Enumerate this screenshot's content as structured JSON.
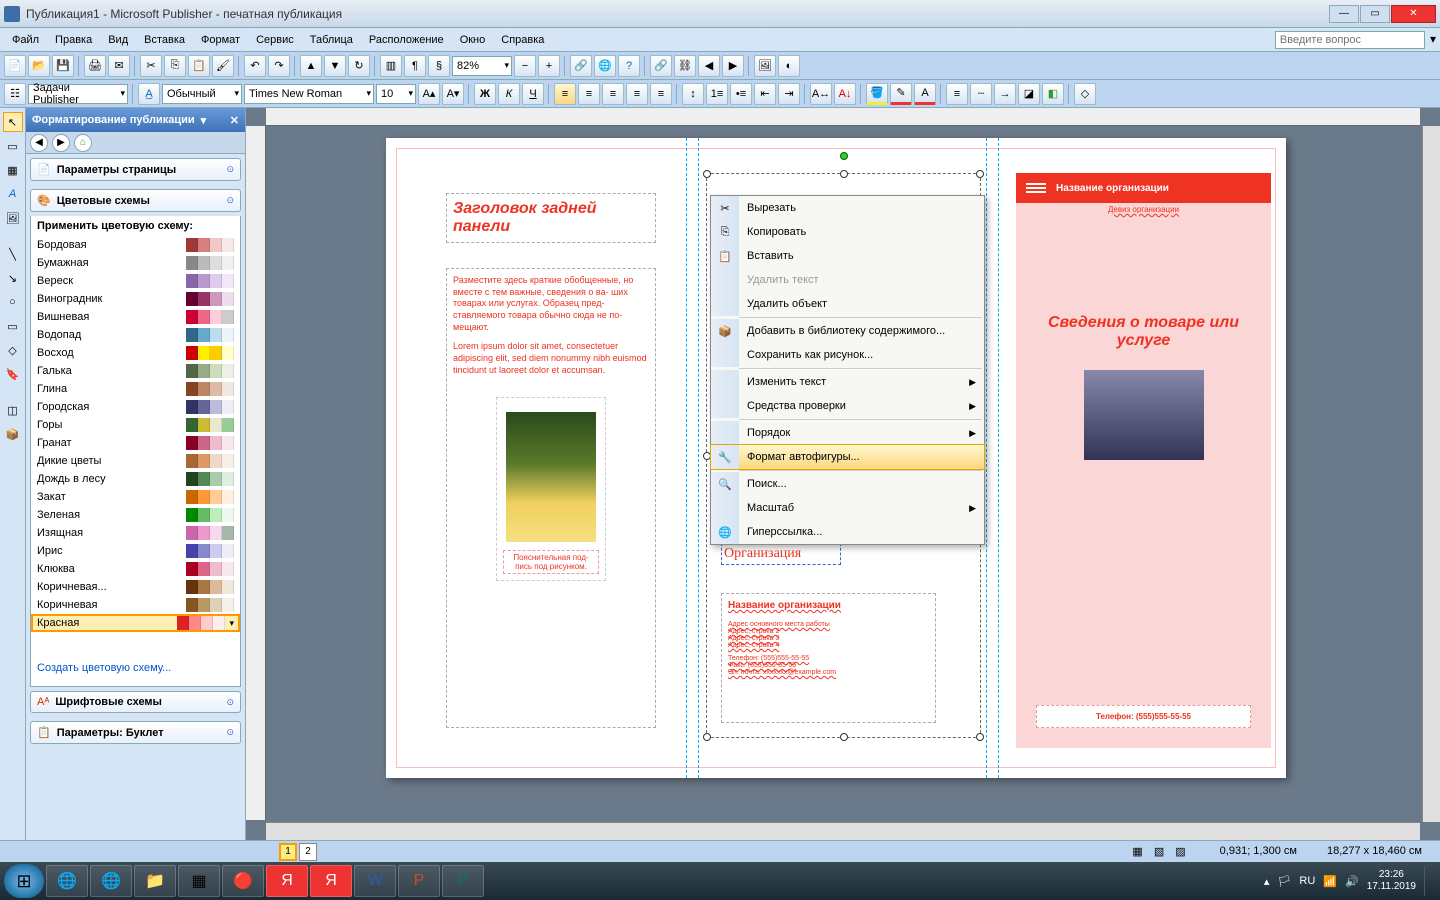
{
  "window": {
    "title": "Публикация1 - Microsoft Publisher - печатная публикация"
  },
  "menu": {
    "items": [
      "Файл",
      "Правка",
      "Вид",
      "Вставка",
      "Формат",
      "Сервис",
      "Таблица",
      "Расположение",
      "Окно",
      "Справка"
    ],
    "help_placeholder": "Введите вопрос"
  },
  "toolbar1": {
    "zoom": "82%",
    "tasks_label": "Задачи Publisher"
  },
  "toolbar2": {
    "style": "Обычный",
    "font": "Times New Roman",
    "size": "10"
  },
  "taskpane": {
    "title": "Форматирование публикации",
    "sections": {
      "page_params": "Параметры страницы",
      "color_schemes": "Цветовые схемы",
      "apply_label": "Применить цветовую схему:",
      "font_schemes": "Шрифтовые схемы",
      "booklet_params": "Параметры: Буклет"
    },
    "create_link": "Создать цветовую схему...",
    "colors": [
      {
        "name": "Бордовая",
        "sw": [
          "#a03838",
          "#d88080",
          "#f0c8c8",
          "#f8e8e8"
        ]
      },
      {
        "name": "Бумажная",
        "sw": [
          "#888888",
          "#bbbbbb",
          "#dddddd",
          "#f0f0f0"
        ]
      },
      {
        "name": "Вереск",
        "sw": [
          "#8866aa",
          "#bb99cc",
          "#ddccee",
          "#f0e8f8"
        ]
      },
      {
        "name": "Виноградник",
        "sw": [
          "#660033",
          "#993366",
          "#cc99bb",
          "#eeddee"
        ]
      },
      {
        "name": "Вишневая",
        "sw": [
          "#cc0033",
          "#ee6688",
          "#ffccdd",
          "#cccccc"
        ]
      },
      {
        "name": "Водопад",
        "sw": [
          "#336688",
          "#66aacc",
          "#bbddee",
          "#eef5fa"
        ]
      },
      {
        "name": "Восход",
        "sw": [
          "#cc0000",
          "#ffee00",
          "#ffcc00",
          "#ffffcc"
        ]
      },
      {
        "name": "Галька",
        "sw": [
          "#556644",
          "#99aa88",
          "#ccddbb",
          "#eef0e8"
        ]
      },
      {
        "name": "Глина",
        "sw": [
          "#884422",
          "#bb8866",
          "#ddbba9",
          "#f0e8e0"
        ]
      },
      {
        "name": "Городская",
        "sw": [
          "#333366",
          "#666699",
          "#bbbbdd",
          "#eeeef5"
        ]
      },
      {
        "name": "Горы",
        "sw": [
          "#336633",
          "#ccbb33",
          "#e8e8cc",
          "#99cc99"
        ]
      },
      {
        "name": "Гранат",
        "sw": [
          "#880022",
          "#cc6688",
          "#eebbcc",
          "#f8e8ee"
        ]
      },
      {
        "name": "Дикие цветы",
        "sw": [
          "#aa6633",
          "#dd9966",
          "#f0d8c8",
          "#f8f0e8"
        ]
      },
      {
        "name": "Дождь в лесу",
        "sw": [
          "#224422",
          "#558855",
          "#aaccaa",
          "#e0eee0"
        ]
      },
      {
        "name": "Закат",
        "sw": [
          "#cc6600",
          "#ff9933",
          "#ffcc99",
          "#fff0e0"
        ]
      },
      {
        "name": "Зеленая",
        "sw": [
          "#008800",
          "#66bb66",
          "#bbeebb",
          "#eef8ee"
        ]
      },
      {
        "name": "Изящная",
        "sw": [
          "#cc66aa",
          "#ee99cc",
          "#f8d8ee",
          "#a8b8a8"
        ]
      },
      {
        "name": "Ирис",
        "sw": [
          "#4444aa",
          "#8888cc",
          "#ccccee",
          "#eeeef8"
        ]
      },
      {
        "name": "Клюква",
        "sw": [
          "#aa0022",
          "#dd6688",
          "#f0bbcc",
          "#f8e8ee"
        ]
      },
      {
        "name": "Коричневая...",
        "sw": [
          "#663311",
          "#aa7744",
          "#ddbb99",
          "#f0e8d8"
        ]
      },
      {
        "name": "Коричневая",
        "sw": [
          "#885522",
          "#bb9966",
          "#e0d0b8",
          "#f5f0e8"
        ]
      },
      {
        "name": "Красная",
        "sw": [
          "#dd2222",
          "#ff8888",
          "#ffcccc",
          "#ffeeee"
        ],
        "selected": true
      }
    ]
  },
  "document": {
    "back_heading": "Заголовок задней панели",
    "back_body1": "Разместите здесь краткие обобщенные, но вместе с тем важные, сведения о ва- ших товарах или услугах. Образец пред- ставляемого товара обычно сюда не по- мещают.",
    "back_body2": "Lorem ipsum dolor sit amet, consectetuer adipiscing elit, sed diem nonummy nibh euismod tincidunt ut laoreet dolor et accumsan.",
    "caption": "Пояснительная под- пись под рисунком.",
    "org_label": "Организация",
    "org_name_hdr": "Название организации",
    "addr1": "Адрес основного места работы",
    "addr2": "Адрес, строка 2",
    "addr3": "Адрес, строка 3",
    "addr4": "Адрес, строка 4",
    "phone": "Телефон: (555)555-55-55",
    "fax": "Факс: (555)555-55-55",
    "email": "Эл. почта: xxxxxxx@example.com",
    "panel3_org": "Название организации",
    "panel3_motto": "Девиз организации",
    "panel3_title": "Сведения о товаре или услуге",
    "panel3_phone": "Телефон: (555)555-55-55"
  },
  "context_menu": {
    "items": [
      {
        "label": "Вырезать",
        "icon": "✂"
      },
      {
        "label": "Копировать",
        "icon": "⎘"
      },
      {
        "label": "Вставить",
        "icon": "📋"
      },
      {
        "label": "Удалить текст",
        "disabled": true
      },
      {
        "label": "Удалить объект"
      },
      {
        "sep": true
      },
      {
        "label": "Добавить в библиотеку содержимого...",
        "icon": "📦"
      },
      {
        "label": "Сохранить как рисунок..."
      },
      {
        "sep": true
      },
      {
        "label": "Изменить текст",
        "sub": true
      },
      {
        "label": "Средства проверки",
        "sub": true
      },
      {
        "sep": true
      },
      {
        "label": "Порядок",
        "sub": true
      },
      {
        "label": "Формат автофигуры...",
        "icon": "🔧",
        "hover": true
      },
      {
        "sep": true
      },
      {
        "label": "Поиск...",
        "icon": "🔍"
      },
      {
        "label": "Масштаб",
        "sub": true
      },
      {
        "label": "Гиперссылка...",
        "icon": "🌐"
      }
    ]
  },
  "status": {
    "page1": "1",
    "page2": "2",
    "pos": "0,931; 1,300 см",
    "size": "18,277 x 18,460 см"
  },
  "taskbar": {
    "lang": "RU",
    "time": "23:26",
    "date": "17.11.2019"
  }
}
